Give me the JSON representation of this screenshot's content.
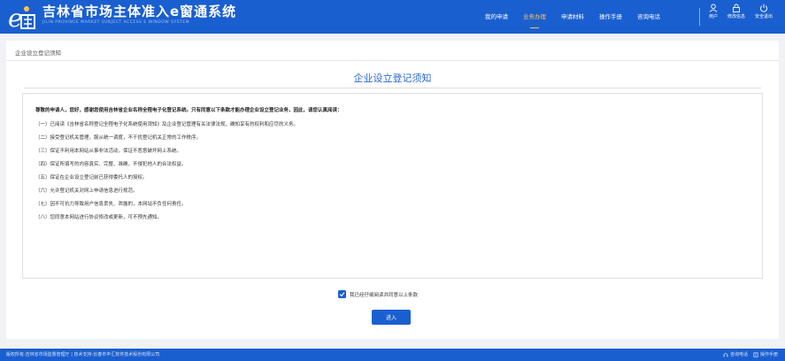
{
  "header": {
    "logo_text": "e通",
    "title": "吉林省市场主体准入e窗通系统",
    "subtitle": "JILIN PROVINCE MARKET SUBJECT ACCESS E WINDOW SYSTEM",
    "nav": [
      {
        "label": "我的申请",
        "active": false
      },
      {
        "label": "业务办理",
        "active": true
      },
      {
        "label": "申请材料",
        "active": false
      },
      {
        "label": "操作手册",
        "active": false
      },
      {
        "label": "咨询电话",
        "active": false
      }
    ],
    "icons": [
      {
        "icon": "user-icon",
        "label": "用户"
      },
      {
        "icon": "lock-icon",
        "label": "修改信息"
      },
      {
        "icon": "power-icon",
        "label": "安全退出"
      }
    ]
  },
  "breadcrumb": "企业设立登记须知",
  "page_title": "企业设立登记须知",
  "terms": {
    "intro": "尊敬的申请人，您好，感谢您使用吉林省企业名称全程电子化登记系统。只有同意以下条款才能办理企业设立登记业务，因此，请您认真阅读：",
    "items": [
      "（一）已阅读《吉林省名称登记全程电子化系统使用须知》及企业登记管理有关法律法规，确知享有的权利和应尽的义务。",
      "（二）接受登记机关管理，服从统一调度，不干扰登记机关正常的工作秩序。",
      "（三）保证不利用本网站从事非法活动，保证不恶意破坏网上系统。",
      "（四）保证所填写的内容真实、完整、准确，不侵犯他人的合法权益。",
      "（五）保证在企业设立登记前已获得委托人的授权。",
      "（六）允许登记机关对网上申请信息进行规范。",
      "（七）因不可抗力导致用户信息丢失、泄露的，本网站不负任何责任。",
      "（八）您同意本网站进行协议修改或更新，可不预先通知。"
    ]
  },
  "agree": {
    "checked": true,
    "label": "我已经仔细阅读并同意以上条款"
  },
  "enter_button": "进入",
  "footer": {
    "copyright": "版权所有:吉林省市场监督管理厅 | 技术支持:长春市丰汇软件技术股份有限公司",
    "links": [
      {
        "icon": "headset-icon",
        "label": "咨询电话"
      },
      {
        "icon": "book-icon",
        "label": "操作手册"
      }
    ]
  },
  "colors": {
    "primary": "#1a5fd0",
    "nav_active": "#ffc24d",
    "title": "#2867d6"
  }
}
